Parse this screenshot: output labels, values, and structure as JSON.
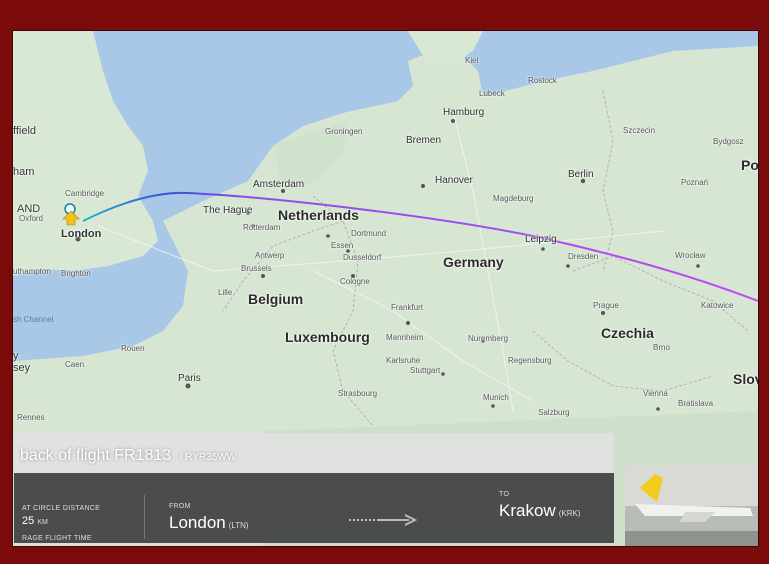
{
  "map": {
    "countries": [
      "Netherlands",
      "Belgium",
      "Luxembourg",
      "Germany",
      "Czechia",
      "Po",
      "Slov"
    ],
    "cities": {
      "sheffield": "ffield",
      "nham": "ham",
      "land": "AND",
      "cambridge": "Cambridge",
      "oxford": "Oxford",
      "london": "London",
      "southampton": "uthampton",
      "brighton": "Brighton",
      "amsterdam": "Amsterdam",
      "hague": "The Hague",
      "rotterdam": "Rotterdam",
      "antwerp": "Antwerp",
      "brussels": "Brussels",
      "lille": "Lille",
      "essen": "Essen",
      "dortmund": "Dortmund",
      "dusseldorf": "Dusseldorf",
      "cologne": "Cologne",
      "frankfurt": "Frankfurt",
      "mannheim": "Mannheim",
      "karlsruhe": "Karlsruhe",
      "stuttgart": "Stuttgart",
      "strasbourg": "Strasbourg",
      "nuremberg": "Nuremberg",
      "regensburg": "Regensburg",
      "munich": "Munich",
      "salzburg": "Salzburg",
      "groningen": "Groningen",
      "bremen": "Bremen",
      "hamburg": "Hamburg",
      "kiel": "Kiel",
      "lubeck": "Lubeck",
      "rostock": "Rostock",
      "hanover": "Hanover",
      "magdeburg": "Magdeburg",
      "berlin": "Berlin",
      "leipzig": "Leipzig",
      "dresden": "Dresden",
      "prague": "Prague",
      "brno": "Brno",
      "vienna": "Vienna",
      "bratislava": "Bratislava",
      "szczecin": "Szczecin",
      "bydgoszcz": "Bydgosz",
      "poznan": "Poznań",
      "wroclaw": "Wrocław",
      "katowice": "Katowice",
      "paris": "Paris",
      "rouen": "Rouen",
      "caen": "Caen",
      "rennes": "Rennes",
      "jersey": "sey",
      "y": "y"
    },
    "water": {
      "channel": "sh Channel"
    }
  },
  "panel": {
    "title_prefix": "back of flight FR1813",
    "registration": "/ RYR35WW",
    "distance_label": "AT CIRCLE DISTANCE",
    "distance_value": "25",
    "distance_unit": "KM",
    "flight_time_label": "RAGE FLIGHT TIME",
    "from_label": "FROM",
    "from_city": "London",
    "from_code": "(LTN)",
    "to_label": "TO",
    "to_city": "Krakow",
    "to_code": "(KRK)"
  },
  "colors": {
    "frame": "#7b0a0a",
    "route_start": "#1fb5c9",
    "route_mid": "#3b4fd6",
    "route_end": "#c24bf0",
    "sea": "#a9c8e8",
    "land": "#d6e6d2"
  }
}
